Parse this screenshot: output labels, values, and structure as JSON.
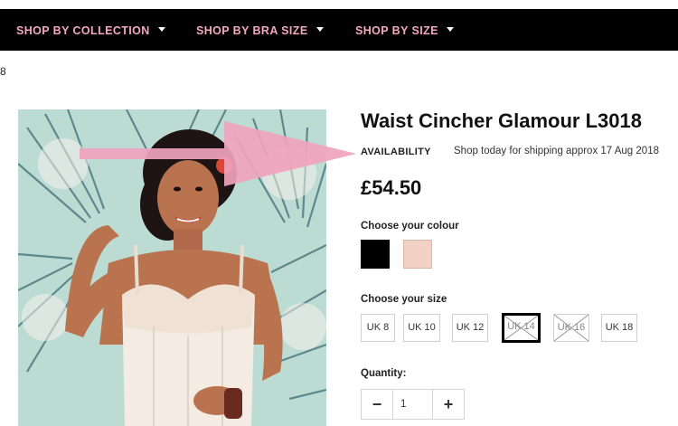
{
  "nav": {
    "items": [
      {
        "label": "SHOP BY COLLECTION"
      },
      {
        "label": "SHOP BY BRA SIZE"
      },
      {
        "label": "SHOP BY SIZE"
      }
    ]
  },
  "stray_text": "8",
  "product": {
    "title": "Waist Cincher Glamour L3018",
    "availability_label": "AVAILABILITY",
    "availability_text": "Shop today for shipping approx 17 Aug 2018",
    "price": "£54.50"
  },
  "colour": {
    "label": "Choose your colour",
    "swatches": [
      {
        "name": "black",
        "color": "#000000",
        "selected": true
      },
      {
        "name": "nude",
        "color": "#f1d2c4",
        "selected": false
      }
    ]
  },
  "size": {
    "label": "Choose your size",
    "options": [
      {
        "label": "UK 8",
        "state": "available"
      },
      {
        "label": "UK 10",
        "state": "available"
      },
      {
        "label": "UK 12",
        "state": "available"
      },
      {
        "label": "UK 14",
        "state": "selected-soldout"
      },
      {
        "label": "UK 16",
        "state": "soldout"
      },
      {
        "label": "UK 18",
        "state": "available"
      }
    ]
  },
  "quantity": {
    "label": "Quantity:",
    "value": "1",
    "minus_symbol": "−",
    "plus_symbol": "+"
  },
  "colors": {
    "nav_bg": "#000000",
    "nav_text": "#f4a7bf",
    "arrow": "#f0a3bd"
  }
}
